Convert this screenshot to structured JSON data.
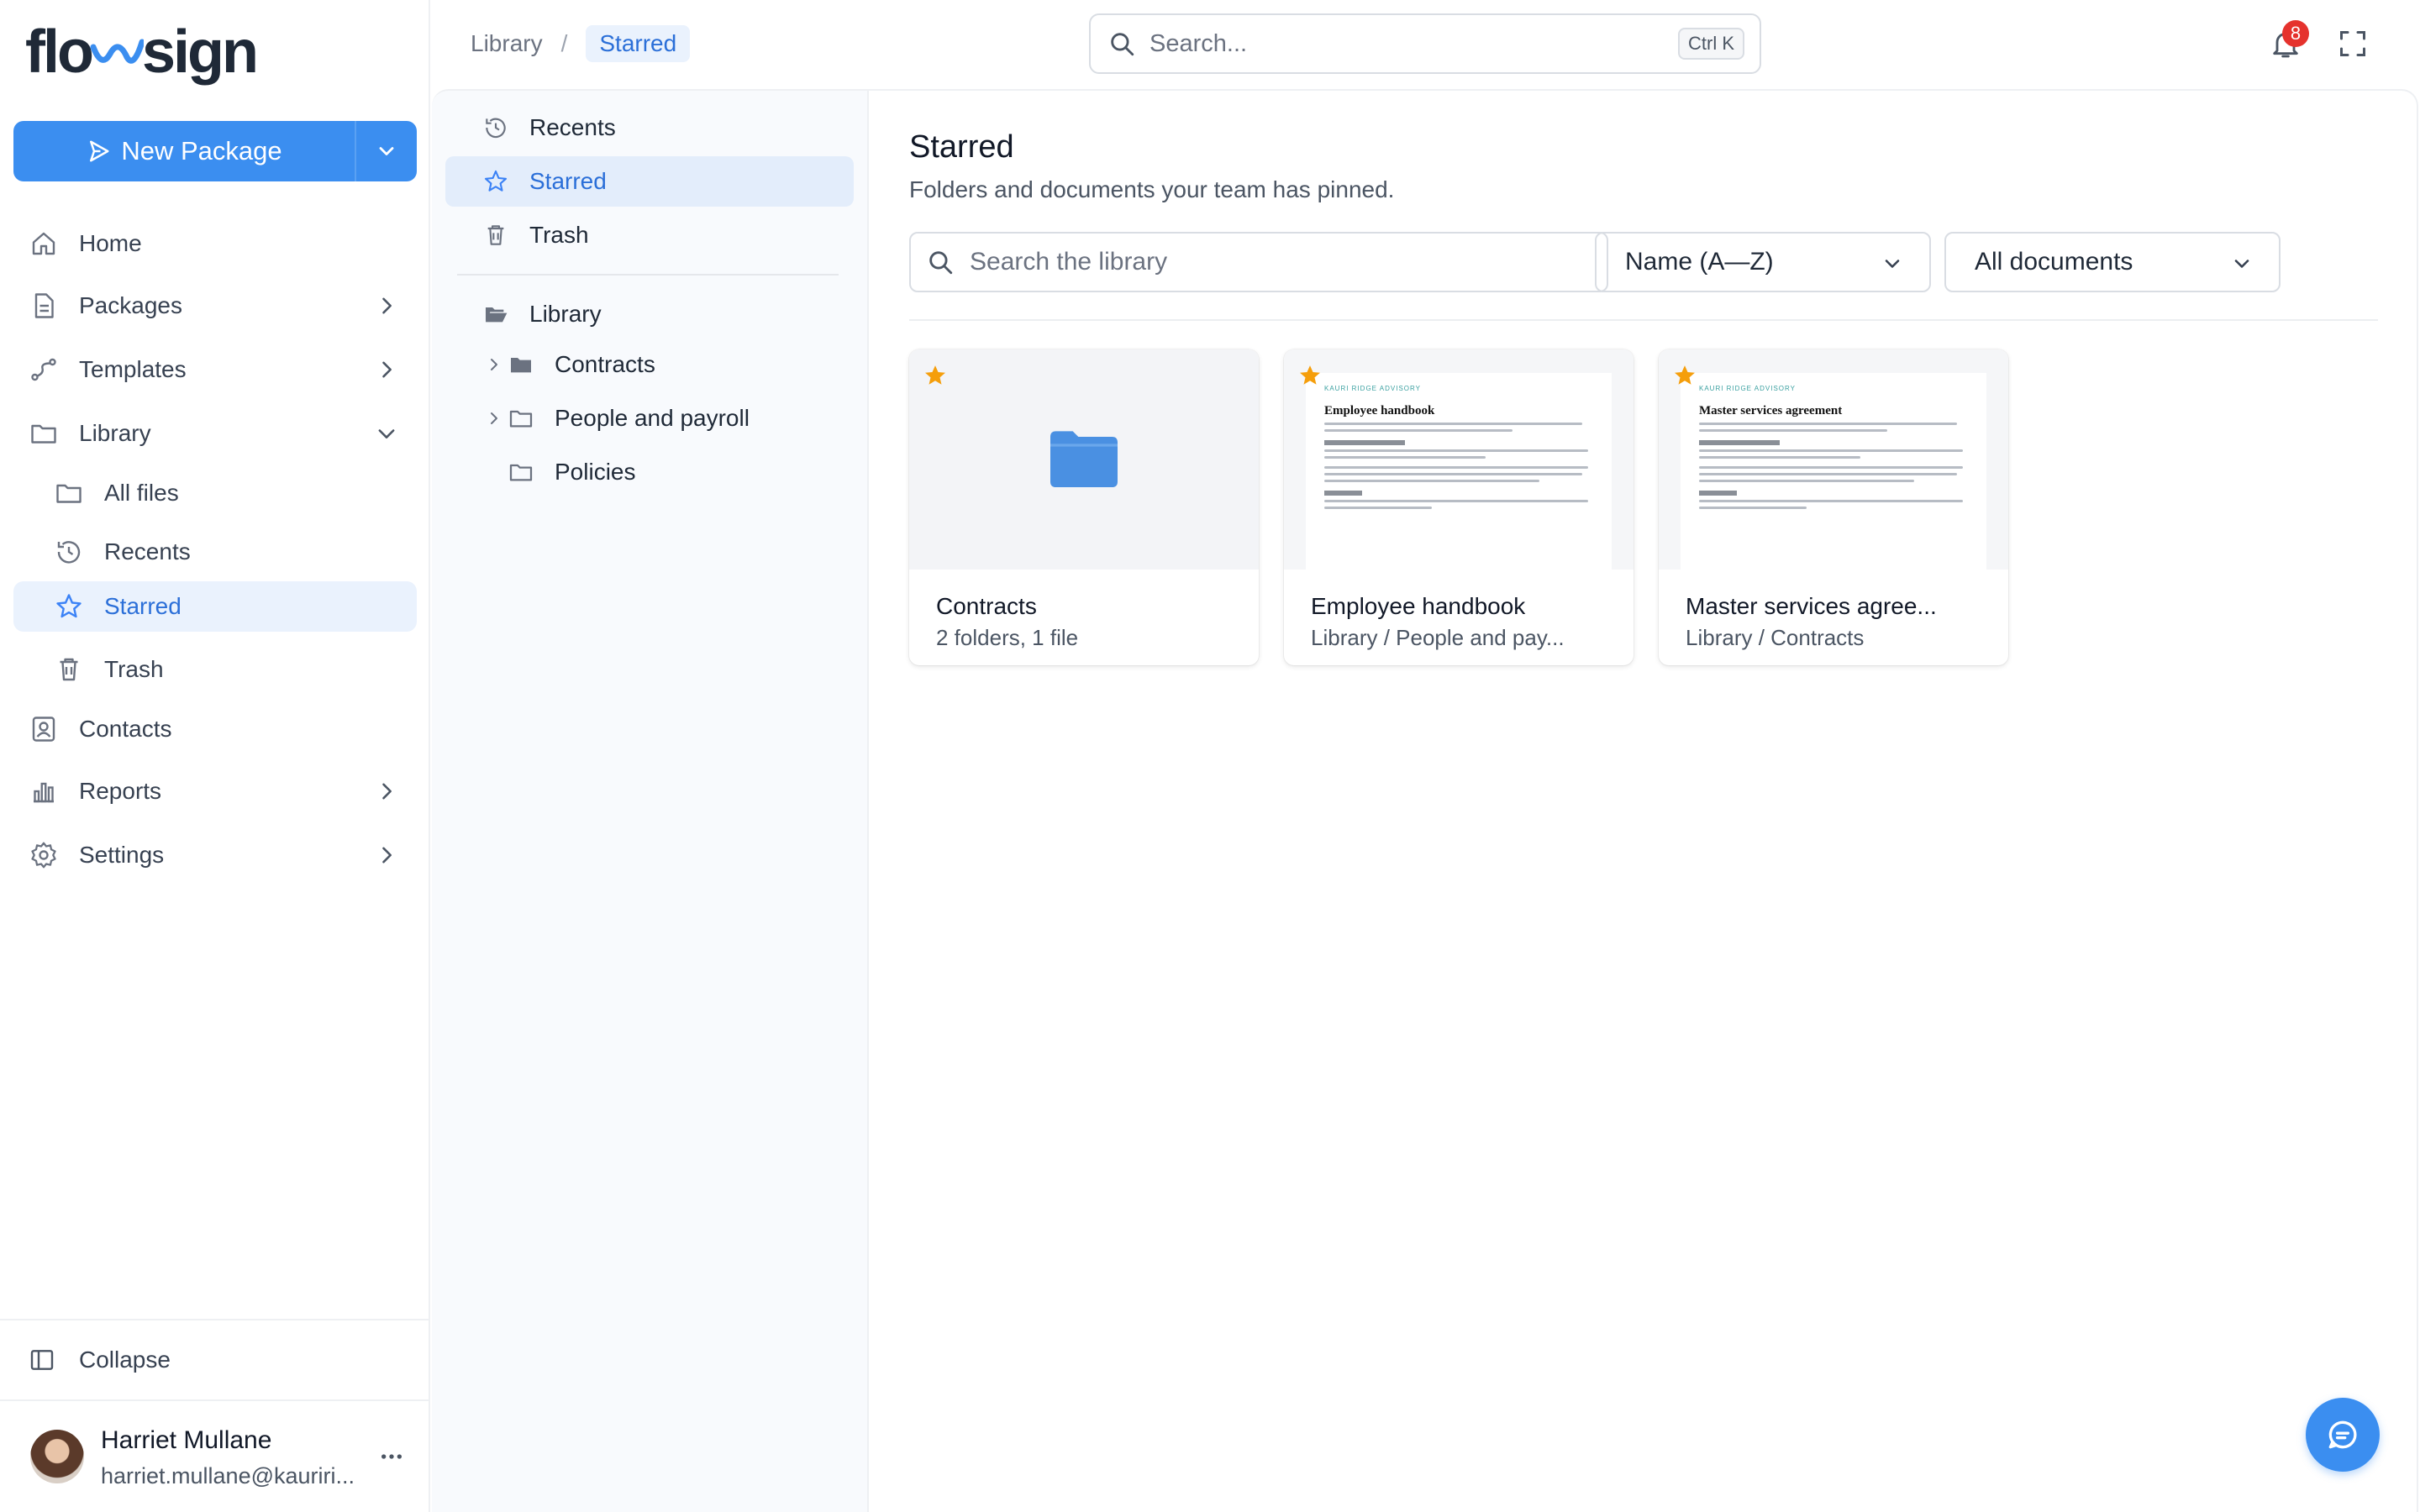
{
  "app": {
    "logo_left": "flo",
    "logo_right": "sign"
  },
  "sidebar": {
    "new_package_label": "New Package",
    "nav": [
      {
        "label": "Home",
        "icon": "home-icon"
      },
      {
        "label": "Packages",
        "icon": "document-icon"
      },
      {
        "label": "Templates",
        "icon": "route-icon"
      },
      {
        "label": "Library",
        "icon": "folder-icon"
      },
      {
        "label": "All files",
        "icon": "folder-icon"
      },
      {
        "label": "Recents",
        "icon": "history-icon"
      },
      {
        "label": "Starred",
        "icon": "star-icon"
      },
      {
        "label": "Trash",
        "icon": "trash-icon"
      },
      {
        "label": "Contacts",
        "icon": "contact-icon"
      },
      {
        "label": "Reports",
        "icon": "bar-chart-icon"
      },
      {
        "label": "Settings",
        "icon": "gear-icon"
      }
    ],
    "collapse_label": "Collapse",
    "user": {
      "name": "Harriet Mullane",
      "email": "harriet.mullane@kauriri..."
    }
  },
  "header": {
    "breadcrumb": [
      "Library",
      "Starred"
    ],
    "search_placeholder": "Search...",
    "shortcut": "Ctrl K",
    "notification_count": "8"
  },
  "tree": {
    "quick": [
      {
        "label": "Recents"
      },
      {
        "label": "Starred"
      },
      {
        "label": "Trash"
      }
    ],
    "root_label": "Library",
    "folders": [
      {
        "label": "Contracts"
      },
      {
        "label": "People and payroll"
      },
      {
        "label": "Policies"
      }
    ]
  },
  "main": {
    "title": "Starred",
    "subtitle": "Folders and documents your team has pinned.",
    "search_placeholder": "Search the library",
    "sort_value": "Name (A—Z)",
    "filter_value": "All documents",
    "cards": [
      {
        "title": "Contracts",
        "meta": "2 folders, 1 file",
        "kind": "folder"
      },
      {
        "title": "Employee handbook",
        "meta": "Library / People and pay...",
        "kind": "document",
        "doc_brand": "KAURI RIDGE ADVISORY",
        "doc_title": "Employee handbook"
      },
      {
        "title": "Master services agree...",
        "meta": "Library / Contracts",
        "kind": "document",
        "doc_brand": "KAURI RIDGE ADVISORY",
        "doc_title": "Master services agreement"
      }
    ]
  },
  "colors": {
    "accent": "#3b8ef0",
    "active_bg": "#eaf2fd",
    "star": "#f59e0b",
    "badge": "#e5322d"
  }
}
